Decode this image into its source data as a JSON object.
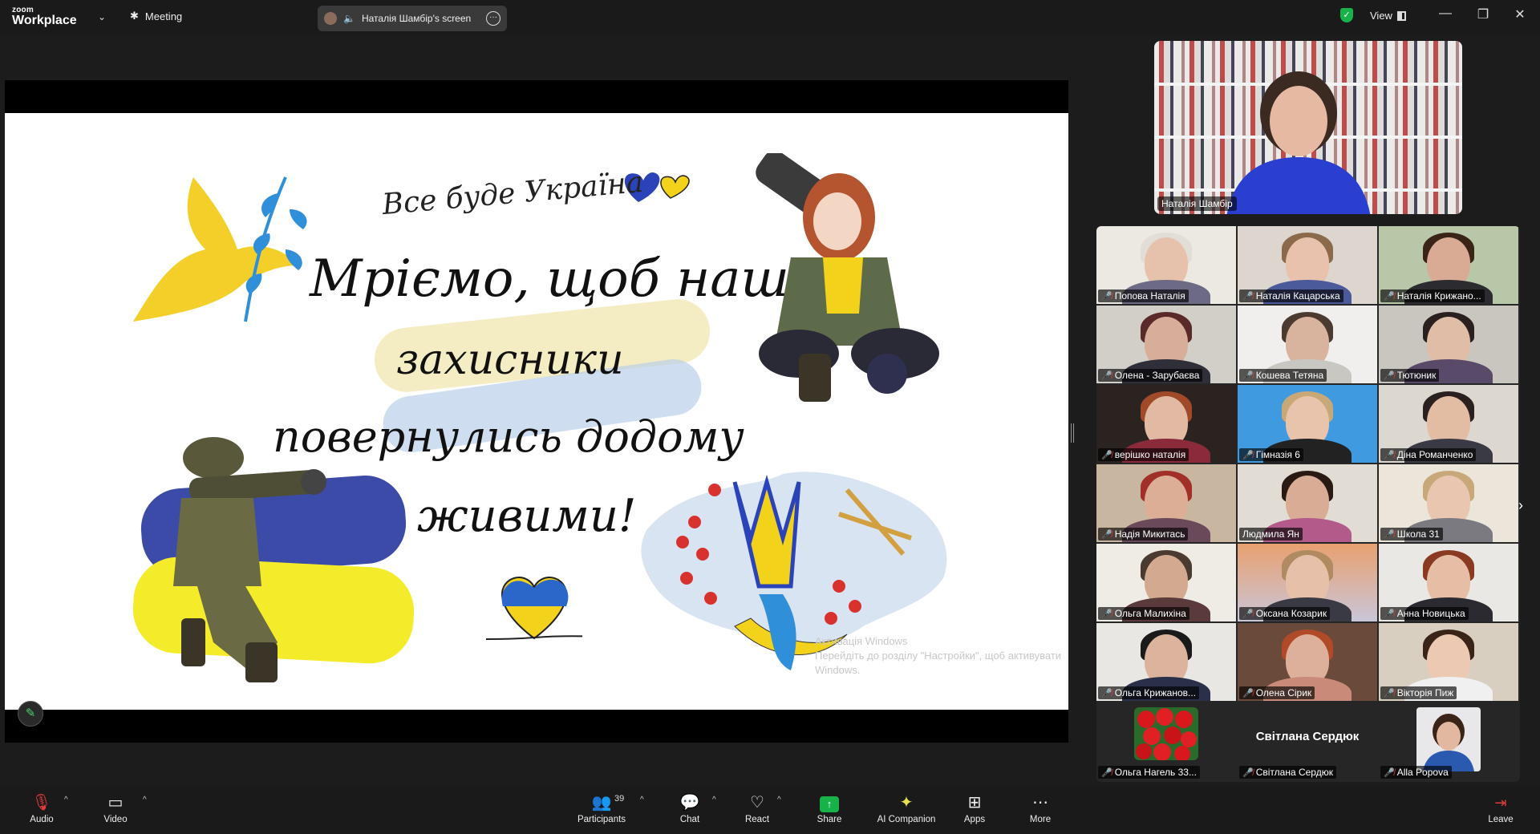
{
  "app": {
    "logo_line1": "zoom",
    "logo_line2": "Workplace",
    "meeting_label": "Meeting",
    "screen_share_label": "Наталія Шамбір's screen",
    "view_label": "View"
  },
  "slide": {
    "script_title": "Все буде Україна",
    "line1": "Мріємо, щоб наші",
    "line2": "захисники",
    "line3": "повернулись додому",
    "line4": "живими!",
    "watermark_line1": "Активація Windows",
    "watermark_line2": "Перейдіть до розділу \"Настройки\", щоб активувати",
    "watermark_line3": "Windows."
  },
  "speaker": {
    "name": "Наталія Шамбір"
  },
  "gallery": {
    "tiles": [
      {
        "name": "Попова Наталія"
      },
      {
        "name": "Наталія Кацарська"
      },
      {
        "name": "Наталія Крижано..."
      },
      {
        "name": "Олена - Зарубаєва"
      },
      {
        "name": "Кошева Тетяна"
      },
      {
        "name": "Тютюник"
      },
      {
        "name": "верішко наталія"
      },
      {
        "name": "Гімназія 6"
      },
      {
        "name": "Діна Романченко"
      },
      {
        "name": "Надія Микитась"
      },
      {
        "name": "Людмила Ян"
      },
      {
        "name": "Школа 31"
      },
      {
        "name": "Ольга Малихіна"
      },
      {
        "name": "Оксана Козарик"
      },
      {
        "name": "Анна Новицька"
      },
      {
        "name": "Ольга Крижанов..."
      },
      {
        "name": "Олена Сірик"
      },
      {
        "name": "Вікторія Пиж"
      },
      {
        "name": "Ольга Нагель 33..."
      },
      {
        "name": "Світлана Сердюк",
        "display_name": "Світлана Сердюк"
      },
      {
        "name": "Alla Popova"
      }
    ]
  },
  "toolbar": {
    "audio": "Audio",
    "video": "Video",
    "participants": "Participants",
    "participants_count": "39",
    "chat": "Chat",
    "react": "React",
    "share": "Share",
    "ai_companion": "AI Companion",
    "apps": "Apps",
    "more": "More",
    "leave": "Leave"
  },
  "colors": {
    "accent_green": "#17b24a",
    "mic_off_red": "#e23b3b",
    "flag_blue": "#3d4ba8",
    "flag_yellow": "#f4ec2a"
  }
}
